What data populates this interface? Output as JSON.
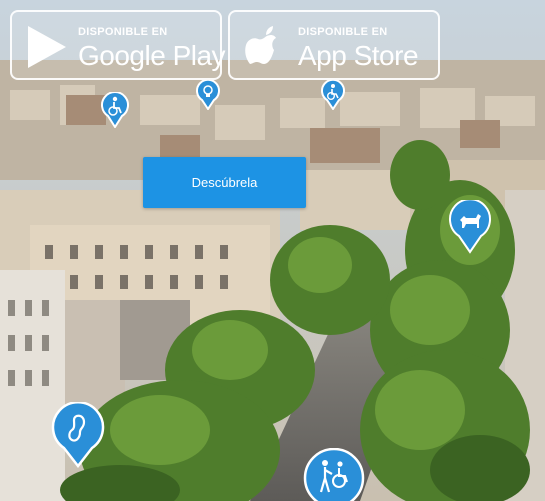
{
  "google_play": {
    "small_label": "DISPONIBLE EN",
    "big_label": "Google Play",
    "icon": "play-triangle-icon"
  },
  "app_store": {
    "small_label": "DISPONIBLE EN",
    "big_label": "App Store",
    "icon": "apple-logo-icon"
  },
  "cta": {
    "label": "Descúbrela"
  },
  "map_pins": [
    {
      "icon": "wheelchair-icon"
    },
    {
      "icon": "lightbulb-icon"
    },
    {
      "icon": "wheelchair-icon"
    },
    {
      "icon": "guide-dog-icon"
    },
    {
      "icon": "ear-icon"
    },
    {
      "icon": "wheelchair-companion-icon"
    }
  ],
  "colors": {
    "accent_blue": "#1d93e4",
    "pin_blue": "#2a8fd8",
    "badge_border": "#ffffff"
  }
}
